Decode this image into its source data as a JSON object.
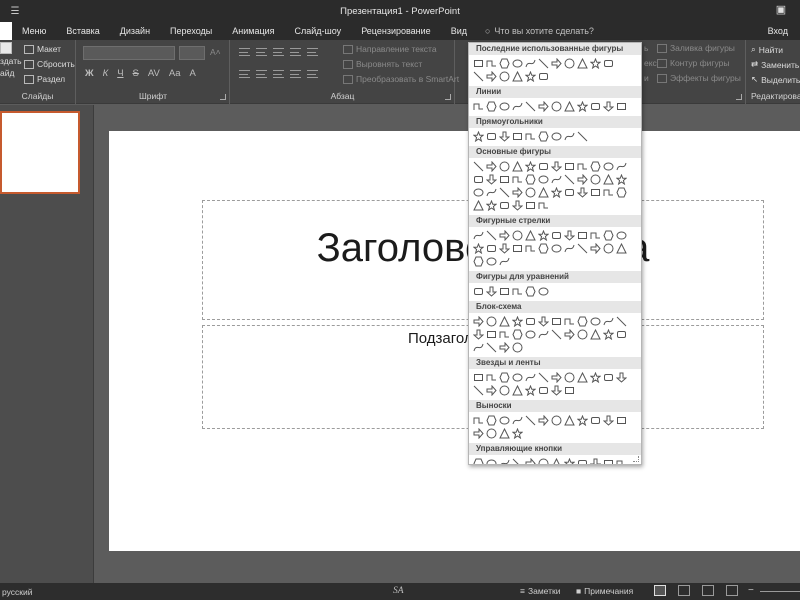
{
  "titlebar": {
    "title": "Презентация1 - PowerPoint",
    "qat_icon": "customize-qat-icon",
    "account_icon": "ribbon-display-options-icon"
  },
  "tabs": {
    "items": [
      "Меню",
      "Вставка",
      "Дизайн",
      "Переходы",
      "Анимация",
      "Слайд-шоу",
      "Рецензирование",
      "Вид"
    ],
    "tellme": "Что вы хотите сделать?",
    "login": "Вход"
  },
  "ribbon": {
    "slides": {
      "label": "Слайды",
      "layout": "Макет",
      "reset": "Сбросить",
      "section": "Раздел",
      "new_slide_top": "здать",
      "new_slide_bottom": "айд"
    },
    "font": {
      "label": "Шрифт"
    },
    "paragraph": {
      "label": "Абзац",
      "text_direction": "Направление текста",
      "align_text": "Выровнять текст",
      "smartart": "Преобразовать в SmartArt"
    },
    "drawing": {
      "fill": "Заливка фигуры",
      "outline": "Контур фигуры",
      "effects": "Эффекты фигуры",
      "partial_1": "ь",
      "partial_2": "екс",
      "partial_3": "и"
    },
    "editing": {
      "label": "Редактирование",
      "find": "Найти",
      "replace": "Заменить",
      "select": "Выделить"
    }
  },
  "slide": {
    "title": "Заголовок слайда",
    "subtitle": "Подзаголовок слайда"
  },
  "gallery": {
    "sections": [
      {
        "title": "Последние использованные фигуры",
        "rows": [
          11,
          6
        ]
      },
      {
        "title": "Линии",
        "rows": [
          12
        ]
      },
      {
        "title": "Прямоугольники",
        "rows": [
          9
        ]
      },
      {
        "title": "Основные фигуры",
        "rows": [
          12,
          12,
          12,
          6
        ]
      },
      {
        "title": "Фигурные стрелки",
        "rows": [
          12,
          12,
          3
        ]
      },
      {
        "title": "Фигуры для уравнений",
        "rows": [
          6
        ]
      },
      {
        "title": "Блок-схема",
        "rows": [
          12,
          12,
          4
        ]
      },
      {
        "title": "Звезды и ленты",
        "rows": [
          12,
          8
        ]
      },
      {
        "title": "Выноски",
        "rows": [
          12,
          4
        ]
      },
      {
        "title": "Управляющие кнопки",
        "rows": [
          12
        ]
      }
    ]
  },
  "status": {
    "language": "русский",
    "watermark": "SA",
    "notes": "Заметки",
    "comments": "Примечания"
  },
  "colors": {
    "titlebar": "#2b2b2b",
    "ribbon": "#444444",
    "workspace": "#5c5c5c",
    "thumb_border": "#c65a2e",
    "gallery_header": "#e6e6e6"
  }
}
